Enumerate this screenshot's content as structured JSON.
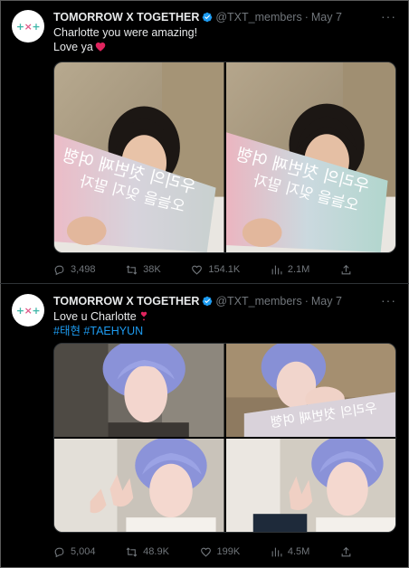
{
  "tweets": [
    {
      "name": "TOMORROW X TOGETHER",
      "handle": "@TXT_members",
      "date": "May 7",
      "line1": "Charlotte you were amazing!",
      "line2": "Love ya",
      "stats": {
        "replies": "3,498",
        "retweets": "38K",
        "likes": "154.1K",
        "views": "2.1M"
      }
    },
    {
      "name": "TOMORROW X TOGETHER",
      "handle": "@TXT_members",
      "date": "May 7",
      "line1": "Love u Charlotte",
      "tags": "#태현 #TAEHYUN",
      "stats": {
        "replies": "5,004",
        "retweets": "48.9K",
        "likes": "199K",
        "views": "4.5M"
      }
    }
  ],
  "banner_text": {
    "line1": "우리의 첫번째 여행",
    "line2": "오늘을 잊지 말자"
  },
  "colors": {
    "verified": "#1d9bf0",
    "link": "#1d9bf0",
    "heart": "#f91880",
    "muted": "#71767b",
    "logo_teal": "#3fb6a8",
    "logo_pink": "#e05a8a"
  },
  "icons": {
    "reply": "reply-icon",
    "retweet": "retweet-icon",
    "like": "like-icon",
    "views": "views-icon",
    "share": "share-icon",
    "more": "more-icon",
    "verified": "verified-icon"
  }
}
